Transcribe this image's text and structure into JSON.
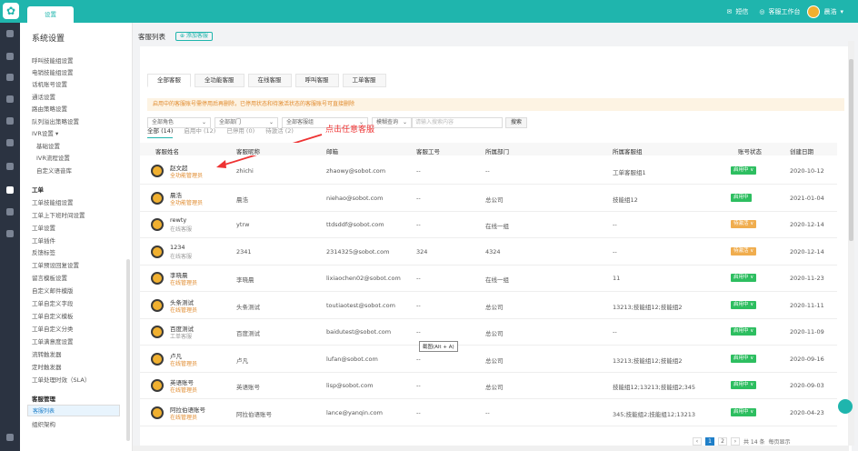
{
  "topbar": {
    "tab_label": "设置",
    "sms_label": "短信",
    "workbench_label": "客服工作台",
    "user_name": "晨浩",
    "accent": "#1fb5ad"
  },
  "sidebar": {
    "title": "系统设置",
    "items": [
      "呼叫技能组设置",
      "电销技能组设置",
      "话机账号设置",
      "通话设置",
      "路由策略设置",
      "队列溢出策略设置",
      "IVR设置 ▾",
      "基础设置",
      "IVR流程设置",
      "自定义语音库",
      "工单",
      "工单技能组设置",
      "工单上下班时间设置",
      "工单设置",
      "工单插件",
      "反馈标签",
      "工单预设回复设置",
      "留言模板设置",
      "自定义邮件模版",
      "工单自定义字段",
      "工单自定义模板",
      "工单自定义分类",
      "工单满意度设置",
      "流转触发器",
      "定时触发器",
      "工单处理时效（SLA）",
      "客服管理",
      "客服列表",
      "组织架构"
    ]
  },
  "page": {
    "title": "客服列表",
    "add_button": "⊕ 添加客服",
    "tabs": [
      "全部客服",
      "全功能客服",
      "在线客服",
      "呼叫客服",
      "工单客服"
    ],
    "notice": "启用中的客服账号需停用后再删除，已停用状态和待激活状态的客服账号可直接删除",
    "filters": {
      "role": "全部角色",
      "dept": "全部部门",
      "group": "全部客服组",
      "mode": "模糊查询",
      "search_placeholder": "请输入搜索内容",
      "search_button": "搜索"
    },
    "subtabs": [
      "全部 (14)",
      "启用中 (12)",
      "已停用 (0)",
      "待激活 (2)"
    ],
    "annotation": "点击任意客服",
    "columns": [
      "客服姓名",
      "客服昵称",
      "邮箱",
      "客服工号",
      "所属部门",
      "所属客服组",
      "账号状态",
      "创建日期"
    ],
    "rows": [
      {
        "name": "赵文超",
        "role": "全功能管理员",
        "nick": "zhichi",
        "email": "zhaowy@sobot.com",
        "no": "--",
        "dept": "--",
        "group": "工单客服组1",
        "status": "启用中 ∨",
        "date": "2020-10-12"
      },
      {
        "name": "晨浩",
        "role": "全功能管理员",
        "nick": "晨浩",
        "email": "niehao@sobot.com",
        "no": "--",
        "dept": "总公司",
        "group": "技能组12",
        "status": "启用中",
        "date": "2021-01-04"
      },
      {
        "name": "rewty",
        "role": "在线客服",
        "nick": "ytrw",
        "email": "ttdsddf@sobot.com",
        "no": "--",
        "dept": "在线一组",
        "group": "--",
        "status": "待激活 ∨",
        "date": "2020-12-14"
      },
      {
        "name": "1234",
        "role": "在线客服",
        "nick": "2341",
        "email": "2314325@sobot.com",
        "no": "324",
        "dept": "4324",
        "group": "--",
        "status": "待激活 ∨",
        "date": "2020-12-14"
      },
      {
        "name": "李晓晨",
        "role": "在线管理员",
        "nick": "李晓晨",
        "email": "lixiaochen02@sobot.com",
        "no": "--",
        "dept": "在线一组",
        "group": "11",
        "status": "启用中 ∨",
        "date": "2020-11-23"
      },
      {
        "name": "头条测试",
        "role": "在线管理员",
        "nick": "头条测试",
        "email": "toutiaotest@sobot.com",
        "no": "--",
        "dept": "总公司",
        "group": "13213;技能组12;技能组2",
        "status": "启用中 ∨",
        "date": "2020-11-11"
      },
      {
        "name": "百度测试",
        "role": "工单客服",
        "nick": "百度测试",
        "email": "baidutest@sobot.com",
        "no": "--",
        "dept": "总公司",
        "group": "--",
        "status": "启用中 ∨",
        "date": "2020-11-09"
      },
      {
        "name": "卢凡",
        "role": "在线管理员",
        "nick": "卢凡",
        "email": "lufan@sobot.com",
        "no": "--",
        "dept": "总公司",
        "group": "13213;技能组12;技能组2",
        "status": "启用中 ∨",
        "date": "2020-09-16"
      },
      {
        "name": "英语账号",
        "role": "在线管理员",
        "nick": "英语账号",
        "email": "lisp@sobot.com",
        "no": "--",
        "dept": "总公司",
        "group": "技能组12;13213;技能组2;345",
        "status": "启用中 ∨",
        "date": "2020-09-03"
      },
      {
        "name": "阿拉伯语账号",
        "role": "在线管理员",
        "nick": "阿拉伯语账号",
        "email": "lance@yanqin.com",
        "no": "--",
        "dept": "--",
        "group": "345;技能组2;技能组12;13213",
        "status": "启用中 ∨",
        "date": "2020-04-23"
      }
    ],
    "tooltip": "截图(Alt + A)",
    "pager": {
      "prev": "‹",
      "current": "1",
      "page2": "2",
      "next": "›",
      "total": "共 14 条",
      "size": "每页显示"
    }
  }
}
